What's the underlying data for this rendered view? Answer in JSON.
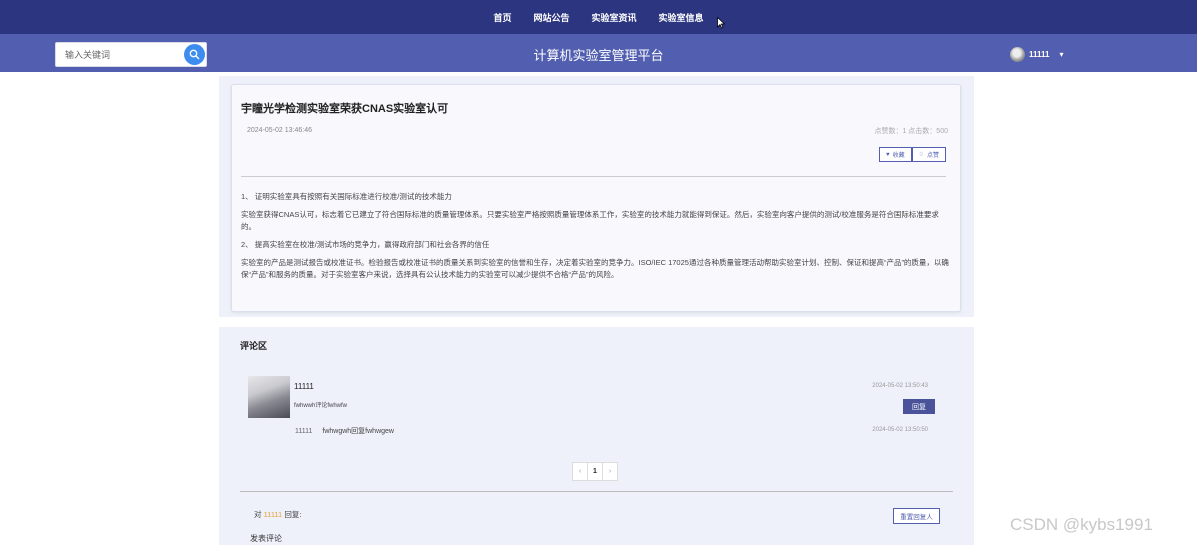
{
  "nav": {
    "items": [
      "首页",
      "网站公告",
      "实验室资讯",
      "实验室信息"
    ]
  },
  "header": {
    "search_placeholder": "输入关键词",
    "title": "计算机实验室管理平台",
    "username": "11111"
  },
  "article": {
    "title": "宇瞳光学检测实验室荣获CNAS实验室认可",
    "date": "2024-05-02 13:46:46",
    "stats": "点赞数：1  点击数：500",
    "favorite_label": "收藏",
    "like_label": "点赞",
    "paragraphs": [
      "1、 证明实验室具有按照有关国际标准进行校准/测试的技术能力",
      "实验室获得CNAS认可，标志着它已建立了符合国际标准的质量管理体系。只要实验室严格按照质量管理体系工作，实验室的技术能力就能得到保证。然后，实验室向客户提供的测试/校准服务是符合国际标准要求的。",
      "2、 提高实验室在校准/测试市场的竞争力，赢得政府部门和社会各界的信任",
      "实验室的产品是测试报告或校准证书。检验报告或校准证书的质量关系到实验室的信誉和生存，决定着实验室的竞争力。ISO/IEC 17025通过各种质量管理活动帮助实验室计划、控制、保证和提高“产品”的质量，以确保“产品”和服务的质量。对于实验室客户来说，选择具有公认技术能力的实验室可以减少提供不合格“产品”的风险。"
    ]
  },
  "comments": {
    "heading": "评论区",
    "items": [
      {
        "user": "11111",
        "text": "fwhwwh评论fwhwfw",
        "time": "2024-05-02 13:50:43",
        "reply_button": "回复",
        "reply": {
          "user": "11111",
          "text": "fwhwgwh回复fwhwgew",
          "time": "2024-05-02 13:50:50"
        }
      }
    ],
    "pager": {
      "prev": "‹",
      "current": "1",
      "next": "›"
    },
    "reply_to_prefix": "对",
    "reply_to_user": "11111",
    "reply_to_suffix": "回复:",
    "reset_button": "重置回复人",
    "post_label": "发表评论"
  },
  "watermark": "CSDN @kybs1991",
  "colors": {
    "nav_bg": "#2c3580",
    "header_bg": "#525fb1",
    "panel_bg": "#eef0fa",
    "accent": "#e6a23c",
    "search_button": "#3d8df0"
  }
}
